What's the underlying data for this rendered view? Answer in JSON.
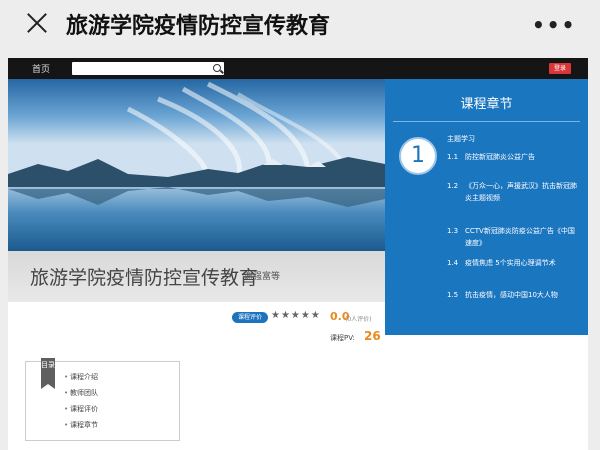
{
  "appbar": {
    "title": "旅游学院疫情防控宣传教育",
    "more": "•••"
  },
  "topnav": {
    "home": "首页",
    "search_placeholder": "",
    "login": "登录"
  },
  "course": {
    "title": "旅游学院疫情防控宣传教育",
    "author": "谢强富等"
  },
  "rating": {
    "badge": "课程评价",
    "stars": "★★★★★",
    "score": "0.0",
    "count": "(0人评价)",
    "pv_label": "课程PV:",
    "pv_value": "26"
  },
  "panel": {
    "title": "课程章节",
    "chapter_number": "1",
    "section": "主题学习",
    "items": [
      {
        "num": "1.1",
        "text": "防控新冠肺炎公益广告"
      },
      {
        "num": "1.2",
        "text": "《万众一心，声援武汉》抗击新冠肺炎主题视频"
      },
      {
        "num": "1.3",
        "text": "CCTV新冠肺炎防疫公益广告《中国速度》"
      },
      {
        "num": "1.4",
        "text": "疫情焦虑 5个实用心理调节术"
      },
      {
        "num": "1.5",
        "text": "抗击疫情，感动中国10大人物"
      }
    ]
  },
  "directory": {
    "tag": "目录",
    "items": [
      "课程介绍",
      "教师团队",
      "课程评价",
      "课程章节"
    ]
  },
  "colors": {
    "accent": "#1b76c0",
    "score": "#e88a1d",
    "login": "#d9363a"
  },
  "icons": {
    "close": "close-icon",
    "more": "more-icon",
    "search": "search-icon"
  }
}
